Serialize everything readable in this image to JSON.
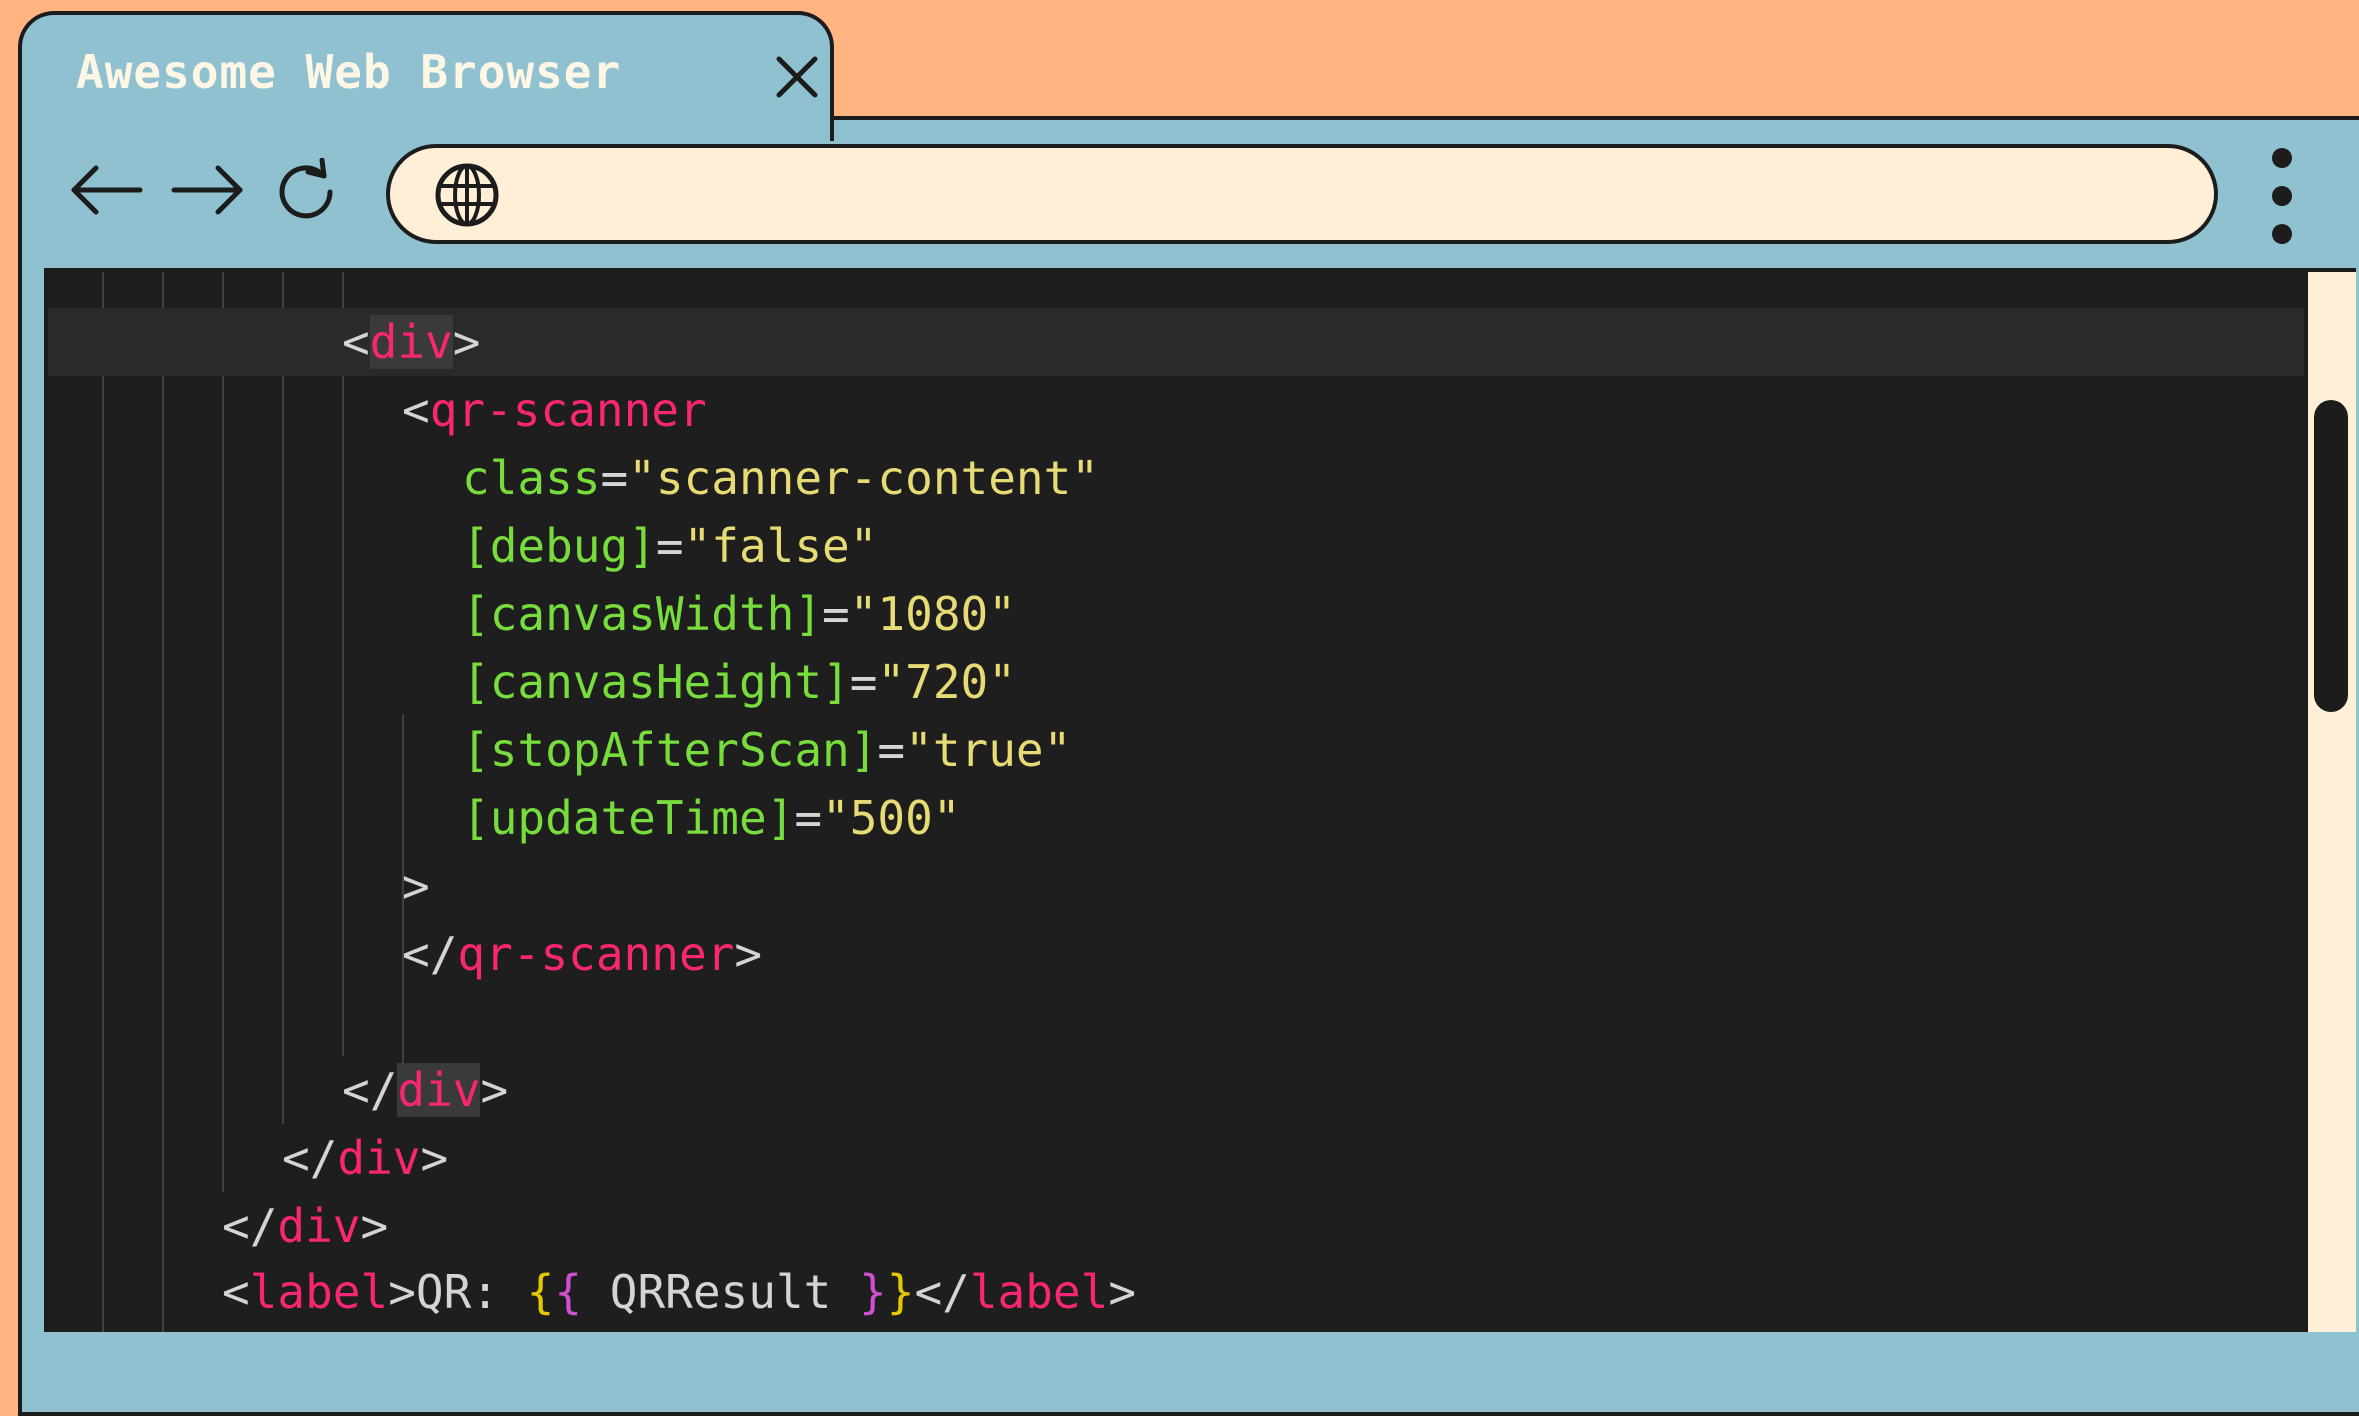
{
  "browser": {
    "tab_title": "Awesome Web Browser",
    "address_value": "",
    "icons": [
      "close-icon",
      "back-arrow-icon",
      "forward-arrow-icon",
      "reload-icon",
      "globe-icon",
      "kebab-menu-icon"
    ]
  },
  "code": {
    "l1": {
      "open": "<",
      "tag": "div",
      "close": ">"
    },
    "l2": {
      "open": "<",
      "tag": "qr-scanner"
    },
    "l3": {
      "attr": "class",
      "eq": "=",
      "val": "\"scanner-content\""
    },
    "l4": {
      "attr": "[debug]",
      "eq": "=",
      "val": "\"false\""
    },
    "l5": {
      "attr": "[canvasWidth]",
      "eq": "=",
      "val": "\"1080\""
    },
    "l6": {
      "attr": "[canvasHeight]",
      "eq": "=",
      "val": "\"720\""
    },
    "l7": {
      "attr": "[stopAfterScan]",
      "eq": "=",
      "val": "\"true\""
    },
    "l8": {
      "attr": "[updateTime]",
      "eq": "=",
      "val": "\"500\""
    },
    "l9": {
      "close": ">"
    },
    "l10": {
      "open": "</",
      "tag": "qr-scanner",
      "close": ">"
    },
    "l12": {
      "open": "</",
      "tag": "div",
      "close": ">"
    },
    "l13": {
      "open": "</",
      "tag": "div",
      "close": ">"
    },
    "l14": {
      "open": "</",
      "tag": "div",
      "close": ">"
    },
    "l15": {
      "open": "<",
      "tag": "label",
      "mid": ">QR: ",
      "b1": "{",
      "b2": "{",
      "expr": " QRResult ",
      "b3": "}",
      "b4": "}",
      "close_open": "</",
      "close_tag": "label",
      "close": ">"
    }
  }
}
